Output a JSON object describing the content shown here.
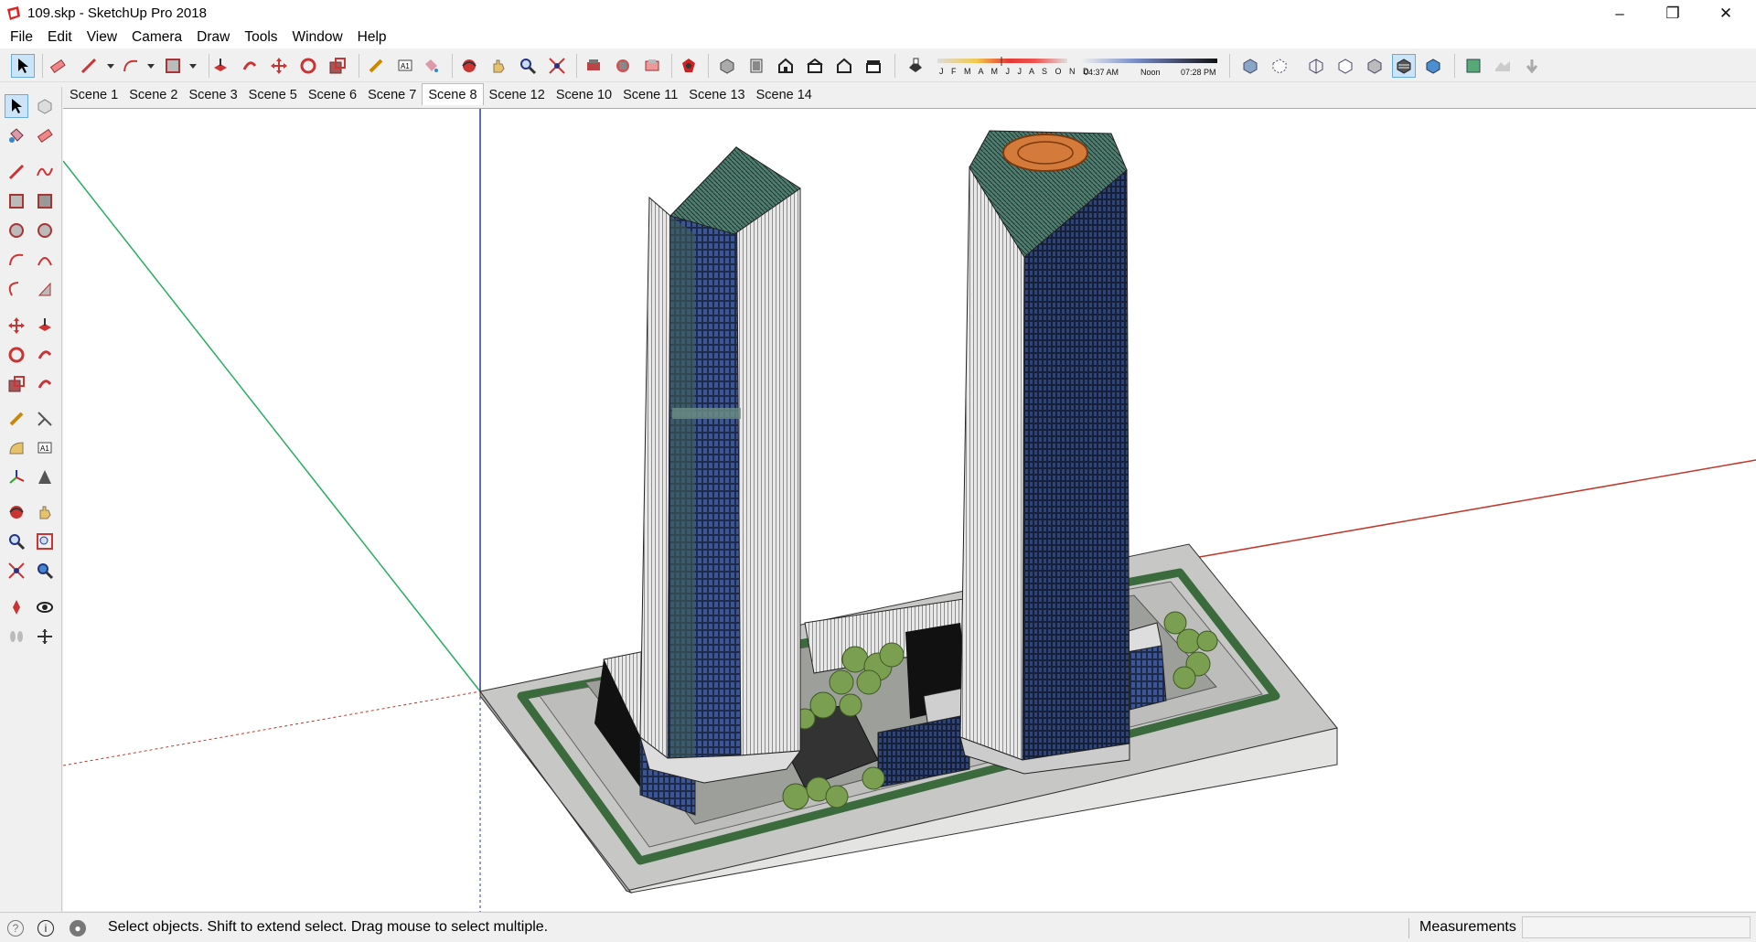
{
  "window": {
    "title": "109.skp - SketchUp Pro 2018"
  },
  "menu": [
    "File",
    "Edit",
    "View",
    "Camera",
    "Draw",
    "Tools",
    "Window",
    "Help"
  ],
  "shadow": {
    "months": "J F M A M J J A S O N D",
    "time_start": "04:37 AM",
    "time_mid": "Noon",
    "time_end": "07:28 PM"
  },
  "scenes": [
    "Scene 1",
    "Scene 2",
    "Scene 3",
    "Scene 5",
    "Scene 6",
    "Scene 7",
    "Scene 8",
    "Scene 12",
    "Scene 10",
    "Scene 11",
    "Scene 13",
    "Scene 14"
  ],
  "active_scene": "Scene 8",
  "status": {
    "hint": "Select objects. Shift to extend select. Drag mouse to select multiple.",
    "measurements_label": "Measurements",
    "measurements_value": ""
  },
  "colors": {
    "accent_select": "#cce4f7",
    "axis_red": "#c0392b",
    "axis_green": "#27ae60",
    "axis_blue": "#2c3e8c"
  }
}
